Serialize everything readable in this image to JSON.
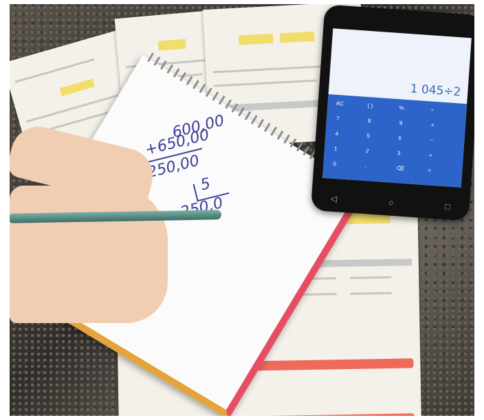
{
  "notebook": {
    "line1": "600,00",
    "line2": "+650,00",
    "line3": "1250,00",
    "divisor": "5",
    "result": "250,0"
  },
  "calculator": {
    "display": "1 045÷2",
    "keys": [
      "AC",
      "( )",
      "%",
      "÷",
      "7",
      "8",
      "9",
      "×",
      "4",
      "5",
      "6",
      "−",
      "1",
      "2",
      "3",
      "+",
      "0",
      ",",
      "⌫",
      "="
    ]
  },
  "colors": {
    "keypad": "#2c64c9",
    "notebook_ink": "#3b3e99",
    "bill_yellow": "#f2dd6a",
    "bill_red": "#f06a5c"
  }
}
